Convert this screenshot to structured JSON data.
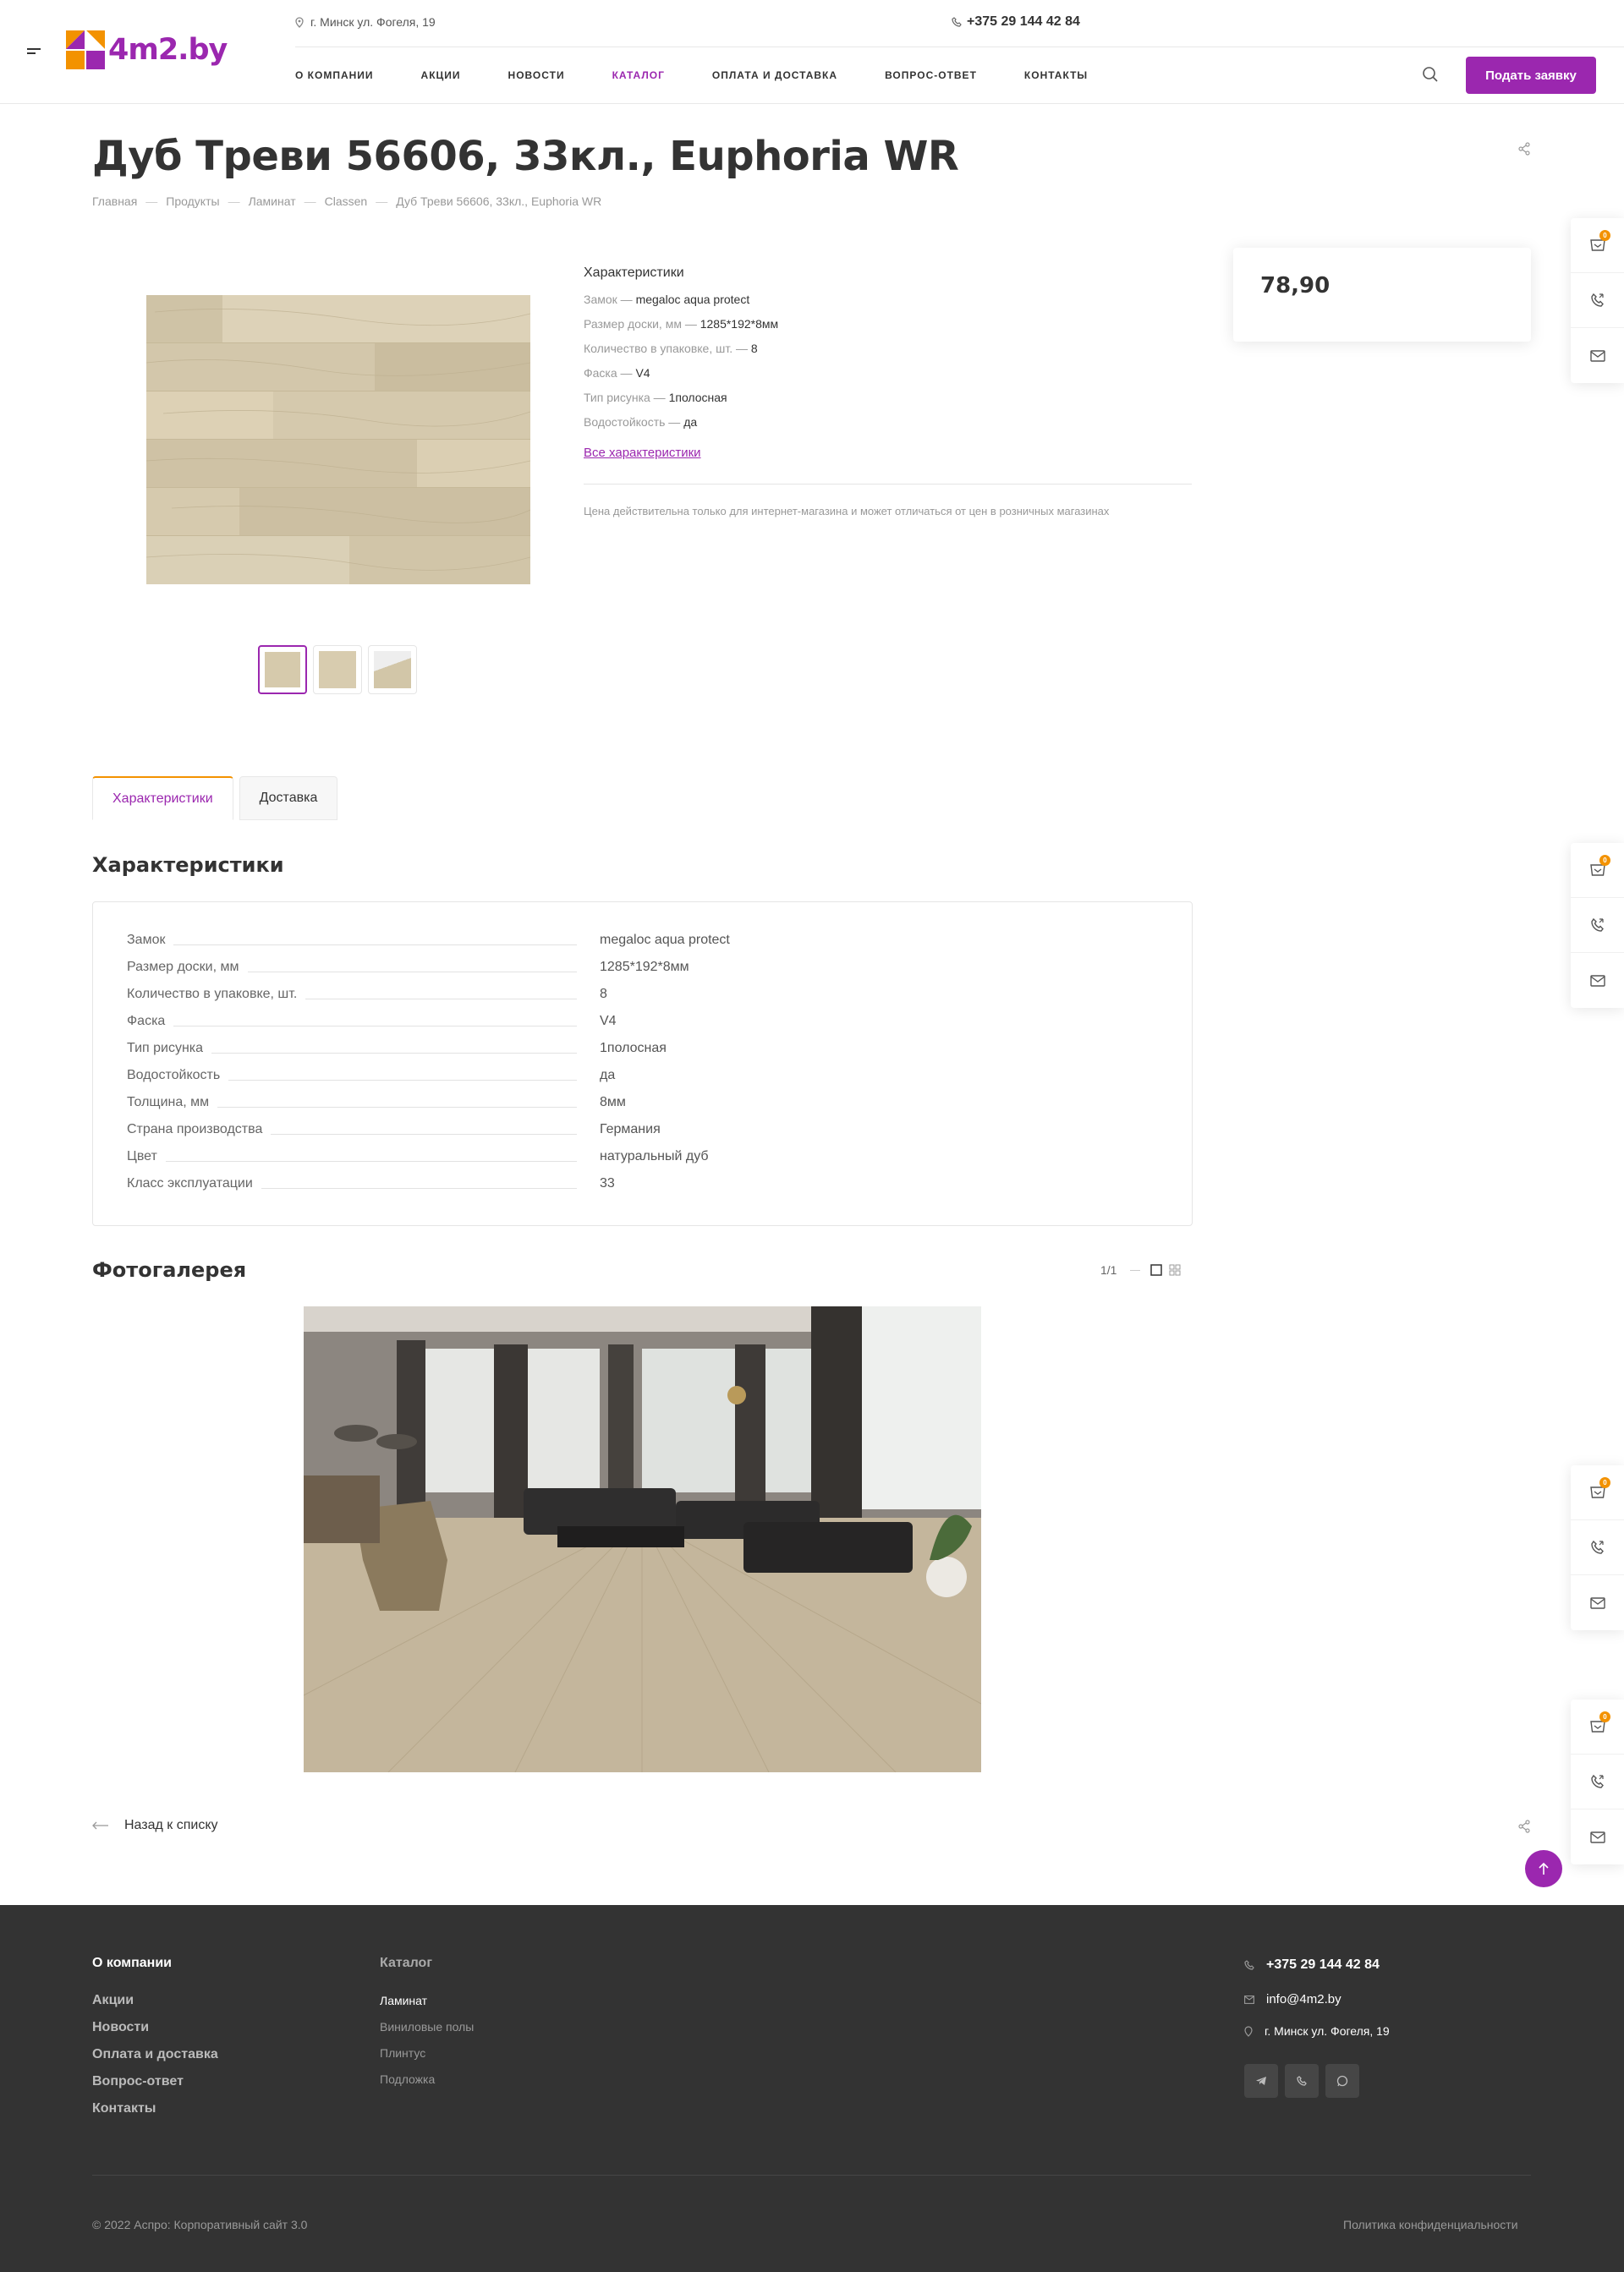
{
  "header": {
    "logo_text": "4m2.by",
    "address": "г. Минск ул. Фогеля, 19",
    "phone": "+375 29 144 42 84",
    "nav": [
      "О компании",
      "Акции",
      "Новости",
      "Каталог",
      "Оплата и доставка",
      "Вопрос-ответ",
      "Контакты"
    ],
    "active_nav": "Каталог",
    "cta_label": "Подать заявку"
  },
  "page": {
    "title": "Дуб Треви 56606, 33кл., Euphoria WR",
    "breadcrumb": [
      "Главная",
      "Продукты",
      "Ламинат",
      "Classen",
      "Дуб Треви 56606, 33кл., Euphoria WR"
    ]
  },
  "product": {
    "props_title": "Характеристики",
    "props": [
      {
        "key": "Замок",
        "value": "megaloc aqua protect"
      },
      {
        "key": "Размер доски, мм",
        "value": "1285*192*8мм"
      },
      {
        "key": "Количество в упаковке, шт.",
        "value": "8"
      },
      {
        "key": "Фаска",
        "value": "V4"
      },
      {
        "key": "Тип рисунка",
        "value": "1полосная"
      },
      {
        "key": "Водостойкость",
        "value": "да"
      }
    ],
    "all_props_link": "Все характеристики",
    "price_note": "Цена действительна только для интернет-магазина и может отличаться от цен в розничных магазинах",
    "price": "78,90",
    "thumb_count": 3
  },
  "side_panel": {
    "cart_count": "0"
  },
  "tabs": {
    "items": [
      "Характеристики",
      "Доставка"
    ],
    "active": "Характеристики"
  },
  "specs": {
    "title": "Характеристики",
    "rows": [
      {
        "key": "Замок",
        "value": "megaloc aqua protect"
      },
      {
        "key": "Размер доски, мм",
        "value": "1285*192*8мм"
      },
      {
        "key": "Количество в упаковке, шт.",
        "value": "8"
      },
      {
        "key": "Фаска",
        "value": "V4"
      },
      {
        "key": "Тип рисунка",
        "value": "1полосная"
      },
      {
        "key": "Водостойкость",
        "value": "да"
      },
      {
        "key": "Толщина, мм",
        "value": "8мм"
      },
      {
        "key": "Страна производства",
        "value": "Германия"
      },
      {
        "key": "Цвет",
        "value": "натуральный дуб"
      },
      {
        "key": "Класс эксплуатации",
        "value": "33"
      }
    ]
  },
  "gallery": {
    "title": "Фотогалерея",
    "counter": "1/1"
  },
  "back_link": "Назад к списку",
  "footer": {
    "company_title": "О компании",
    "company_links": [
      "Акции",
      "Новости",
      "Оплата и доставка",
      "Вопрос-ответ",
      "Контакты"
    ],
    "catalog_title": "Каталог",
    "catalog_links": [
      "Ламинат",
      "Виниловые полы",
      "Плинтус",
      "Подложка"
    ],
    "phone": "+375 29 144 42 84",
    "email": "info@4m2.by",
    "address": "г. Минск ул. Фогеля, 19",
    "copyright": "© 2022 Аспро: Корпоративный сайт 3.0",
    "policy": "Политика конфиденциальности"
  },
  "colors": {
    "accent": "#9b27af",
    "orange": "#f39200",
    "footer_bg": "#333333"
  }
}
